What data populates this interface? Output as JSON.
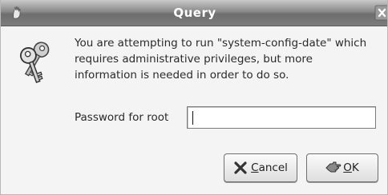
{
  "window": {
    "title": "Query"
  },
  "icons": {
    "window_menu": "window-menu-icon",
    "close": "close-icon",
    "dialog": "keys-icon",
    "cancel": "cancel-x-icon",
    "ok": "ok-hand-icon"
  },
  "message": {
    "lines": [
      "You are attempting to run \"system-config-date\" which",
      "requires administrative privileges, but more",
      "information is needed in order to do so."
    ]
  },
  "password": {
    "label": "Password for root",
    "value": "",
    "placeholder": ""
  },
  "buttons": {
    "cancel": {
      "mnemonic": "C",
      "rest": "ancel"
    },
    "ok": {
      "mnemonic": "O",
      "rest": "K"
    }
  },
  "colors": {
    "titlebar": "#7c7c7c",
    "window_bg": "#f4f4f4"
  }
}
